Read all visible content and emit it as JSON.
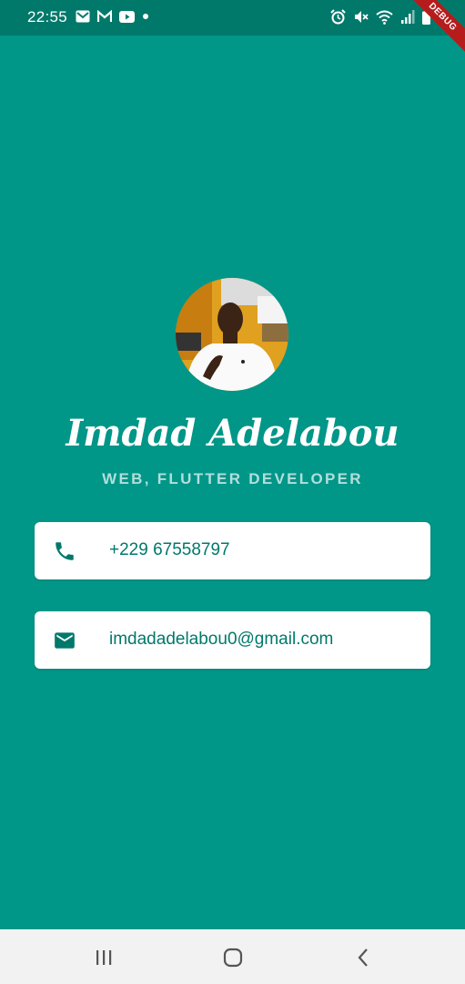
{
  "status": {
    "time": "22:55",
    "left_icons": [
      "mail-icon",
      "gmail-icon",
      "youtube-icon",
      "dot-icon"
    ],
    "right_icons": [
      "alarm-icon",
      "mute-icon",
      "wifi-icon",
      "signal-icon",
      "battery-icon"
    ]
  },
  "debug_banner": "DEBUG",
  "profile": {
    "name": "Imdad Adelabou",
    "title": "WEB, FLUTTER DEVELOPER"
  },
  "contacts": [
    {
      "icon": "phone-icon",
      "text": "+229 67558797"
    },
    {
      "icon": "email-icon",
      "text": "imdadadelabou0@gmail.com"
    }
  ],
  "navbar": [
    "recents-icon",
    "home-icon",
    "back-icon"
  ],
  "colors": {
    "background": "#009688",
    "statusbar": "#00796b",
    "accent": "#00796b",
    "subtitle": "#b2dfdb"
  }
}
